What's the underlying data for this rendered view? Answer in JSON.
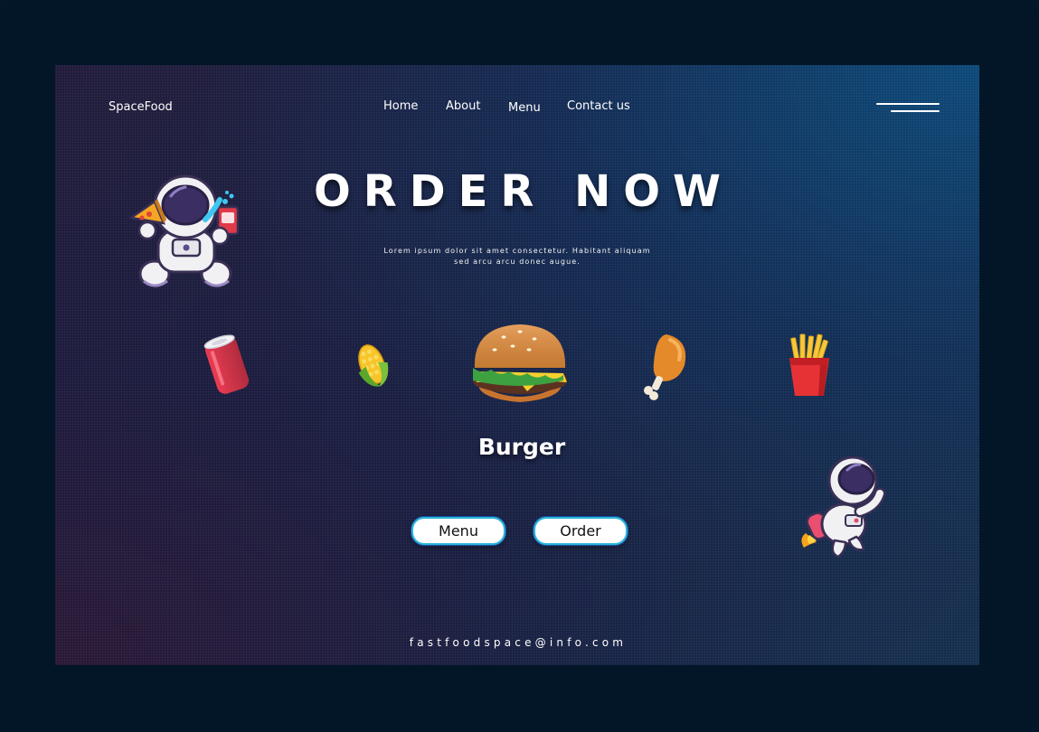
{
  "brand": "SpaceFood",
  "nav": {
    "home": "Home",
    "about": "About",
    "menu": "Menu",
    "contact": "Contact us"
  },
  "hero": {
    "title": "ORDER NOW",
    "subtitle_line1": "Lorem ipsum dolor sit amet consectetur. Habitant aliquam",
    "subtitle_line2": "sed arcu arcu donec augue."
  },
  "carousel": {
    "items": [
      "soda-can-icon",
      "corn-icon",
      "burger-icon",
      "chicken-leg-icon",
      "fries-icon"
    ],
    "selected_label": "Burger"
  },
  "buttons": {
    "menu": "Menu",
    "order": "Order"
  },
  "footer": {
    "email": "fastfoodspace@info.com"
  },
  "colors": {
    "page_bg": "#021628",
    "accent_border": "#2ab6d8"
  }
}
